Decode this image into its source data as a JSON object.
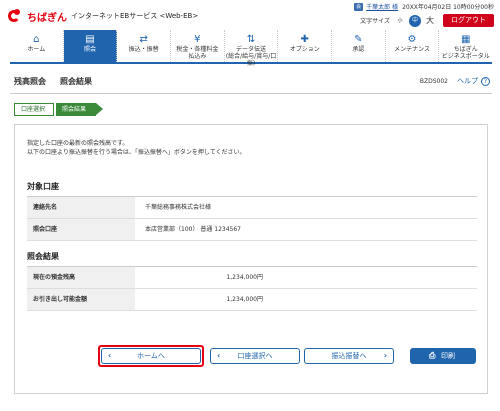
{
  "brand": {
    "logo_text": "ちばぎん",
    "service_name": "インターネットEBサービス <Web-EB>"
  },
  "user": {
    "icon_label": "会",
    "name": "千葉太郎 様",
    "last_login": "20XX年04月02日 10時00分00秒"
  },
  "text_size": {
    "label": "文字サイズ",
    "small": "小",
    "medium": "中",
    "large": "大"
  },
  "logout_label": "ログアウト",
  "nav": [
    {
      "icon": "home-icon",
      "glyph": "⌂",
      "label": "ホーム"
    },
    {
      "icon": "document-icon",
      "glyph": "▤",
      "label": "照会"
    },
    {
      "icon": "transfer-icon",
      "glyph": "⇄",
      "label": "振込・振替"
    },
    {
      "icon": "tax-payment-icon",
      "glyph": "¥",
      "label": "税金・各種料金\n払込み"
    },
    {
      "icon": "data-transmission-icon",
      "glyph": "⇅",
      "label": "データ伝送\n(総合/給与/賞与/口振)"
    },
    {
      "icon": "option-icon",
      "glyph": "✚",
      "label": "オプション"
    },
    {
      "icon": "approval-icon",
      "glyph": "✎",
      "label": "承認"
    },
    {
      "icon": "maintenance-icon",
      "glyph": "⚙",
      "label": "メンテナンス"
    },
    {
      "icon": "portal-icon",
      "glyph": "▦",
      "label": "ちばぎん\nビジネスポータル"
    }
  ],
  "page": {
    "category": "残高照会",
    "title": "照会結果",
    "screen_id": "BZDS002",
    "help_label": "ヘルプ"
  },
  "steps": [
    "口座選択",
    "照会結果"
  ],
  "intro_lines": [
    "指定した口座の最新の照会残高です。",
    "以下の口座より振込振替を行う場合は、「振込振替へ」ボタンを押してください。"
  ],
  "target_account": {
    "section_title": "対象口座",
    "rows": [
      {
        "key": "連絡先名",
        "value": "千葉総務事務株式会社様"
      },
      {
        "key": "照会口座",
        "value": "本店営業部（100） 普通 1234567"
      }
    ]
  },
  "result": {
    "section_title": "照会結果",
    "rows": [
      {
        "key": "現在の預金残高",
        "value": "1,234,000円"
      },
      {
        "key": "お引き出し可能金額",
        "value": "1,234,000円"
      }
    ]
  },
  "buttons": {
    "home": "ホームへ",
    "account_select": "口座選択へ",
    "transfer": "振込振替へ",
    "print": "印刷"
  }
}
